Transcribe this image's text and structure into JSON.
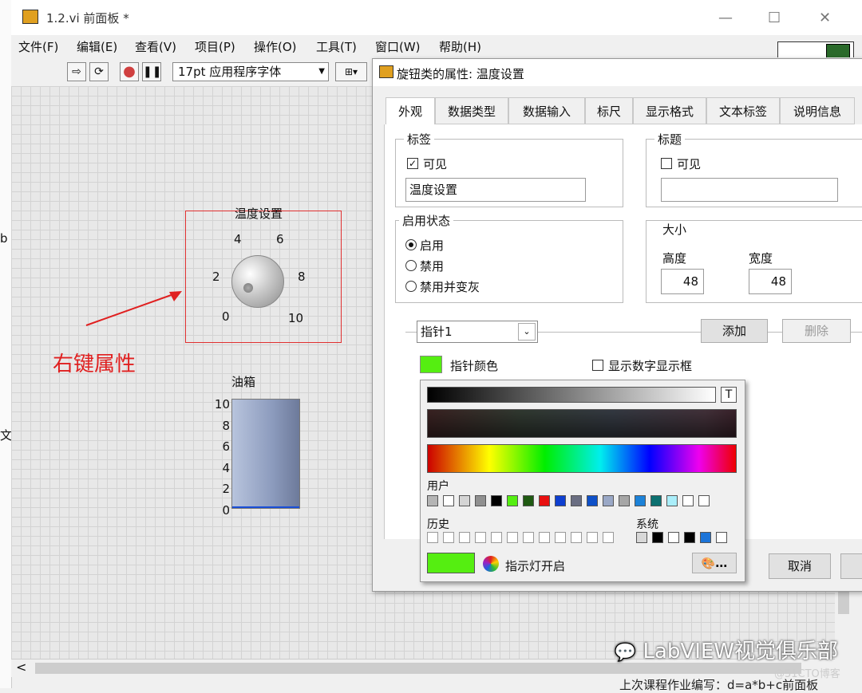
{
  "window": {
    "title": "1.2.vi 前面板 *",
    "menus": [
      "文件(F)",
      "编辑(E)",
      "查看(V)",
      "项目(P)",
      "操作(O)",
      "工具(T)",
      "窗口(W)",
      "帮助(H)"
    ],
    "font_selector": "17pt 应用程序字体"
  },
  "front_panel": {
    "knob": {
      "label": "温度设置",
      "ticks": [
        "0",
        "2",
        "4",
        "6",
        "8",
        "10"
      ]
    },
    "tank": {
      "label": "油箱",
      "ticks": [
        "10",
        "8",
        "6",
        "4",
        "2",
        "0"
      ],
      "level": 10
    },
    "annotation": "右键属性",
    "left_edge_text_1": "b",
    "left_edge_text_2": "文"
  },
  "dialog": {
    "title": "旋钮类的属性: 温度设置",
    "tabs": [
      "外观",
      "数据类型",
      "数据输入",
      "标尺",
      "显示格式",
      "文本标签",
      "说明信息"
    ],
    "label_group": {
      "title": "标签",
      "visible_label": "可见",
      "visible_checked": true,
      "value": "温度设置"
    },
    "caption_group": {
      "title": "标题",
      "visible_label": "可见",
      "visible_checked": false,
      "value": ""
    },
    "enable_group": {
      "title": "启用状态",
      "options": [
        "启用",
        "禁用",
        "禁用并变灰"
      ],
      "selected": "启用"
    },
    "size_group": {
      "title": "大小",
      "height_label": "高度",
      "height_value": "48",
      "width_label": "宽度",
      "width_value": "48"
    },
    "needle": {
      "selector": "指针1",
      "add_button": "添加",
      "delete_button": "删除",
      "color_label": "指针颜色",
      "color": "#55ee11",
      "show_digital_label": "显示数字显示框",
      "show_digital_checked": false
    },
    "cancel_button": "取消"
  },
  "color_picker": {
    "user_label": "用户",
    "history_label": "历史",
    "system_label": "系统",
    "indicator_label": "指示灯开启",
    "transparent_glyph": "T",
    "more_button": "…",
    "current_color": "#55ee11",
    "user_colors": [
      "#b4b4b4",
      "#ffffff",
      "#d4d4d4",
      "#909090",
      "#000000",
      "#55ee11",
      "#1f5a12",
      "#e81010",
      "#0e3fd0",
      "#6a6e82",
      "#0e50c8",
      "#9aa8c6",
      "#a6a6a6",
      "#1c82d8",
      "#0c7070",
      "#aaeefa",
      "#ffffff",
      "#ffffff"
    ],
    "system_colors": [
      "#d8d8d8",
      "#000000",
      "#ffffff",
      "#000000",
      "#1c74d8",
      "#ffffff"
    ]
  },
  "watermark": "LabVIEW视觉俱乐部",
  "watermark2": "@51CTO博客",
  "bottom_text": "上次课程作业编写：d=a*b+c前面板"
}
